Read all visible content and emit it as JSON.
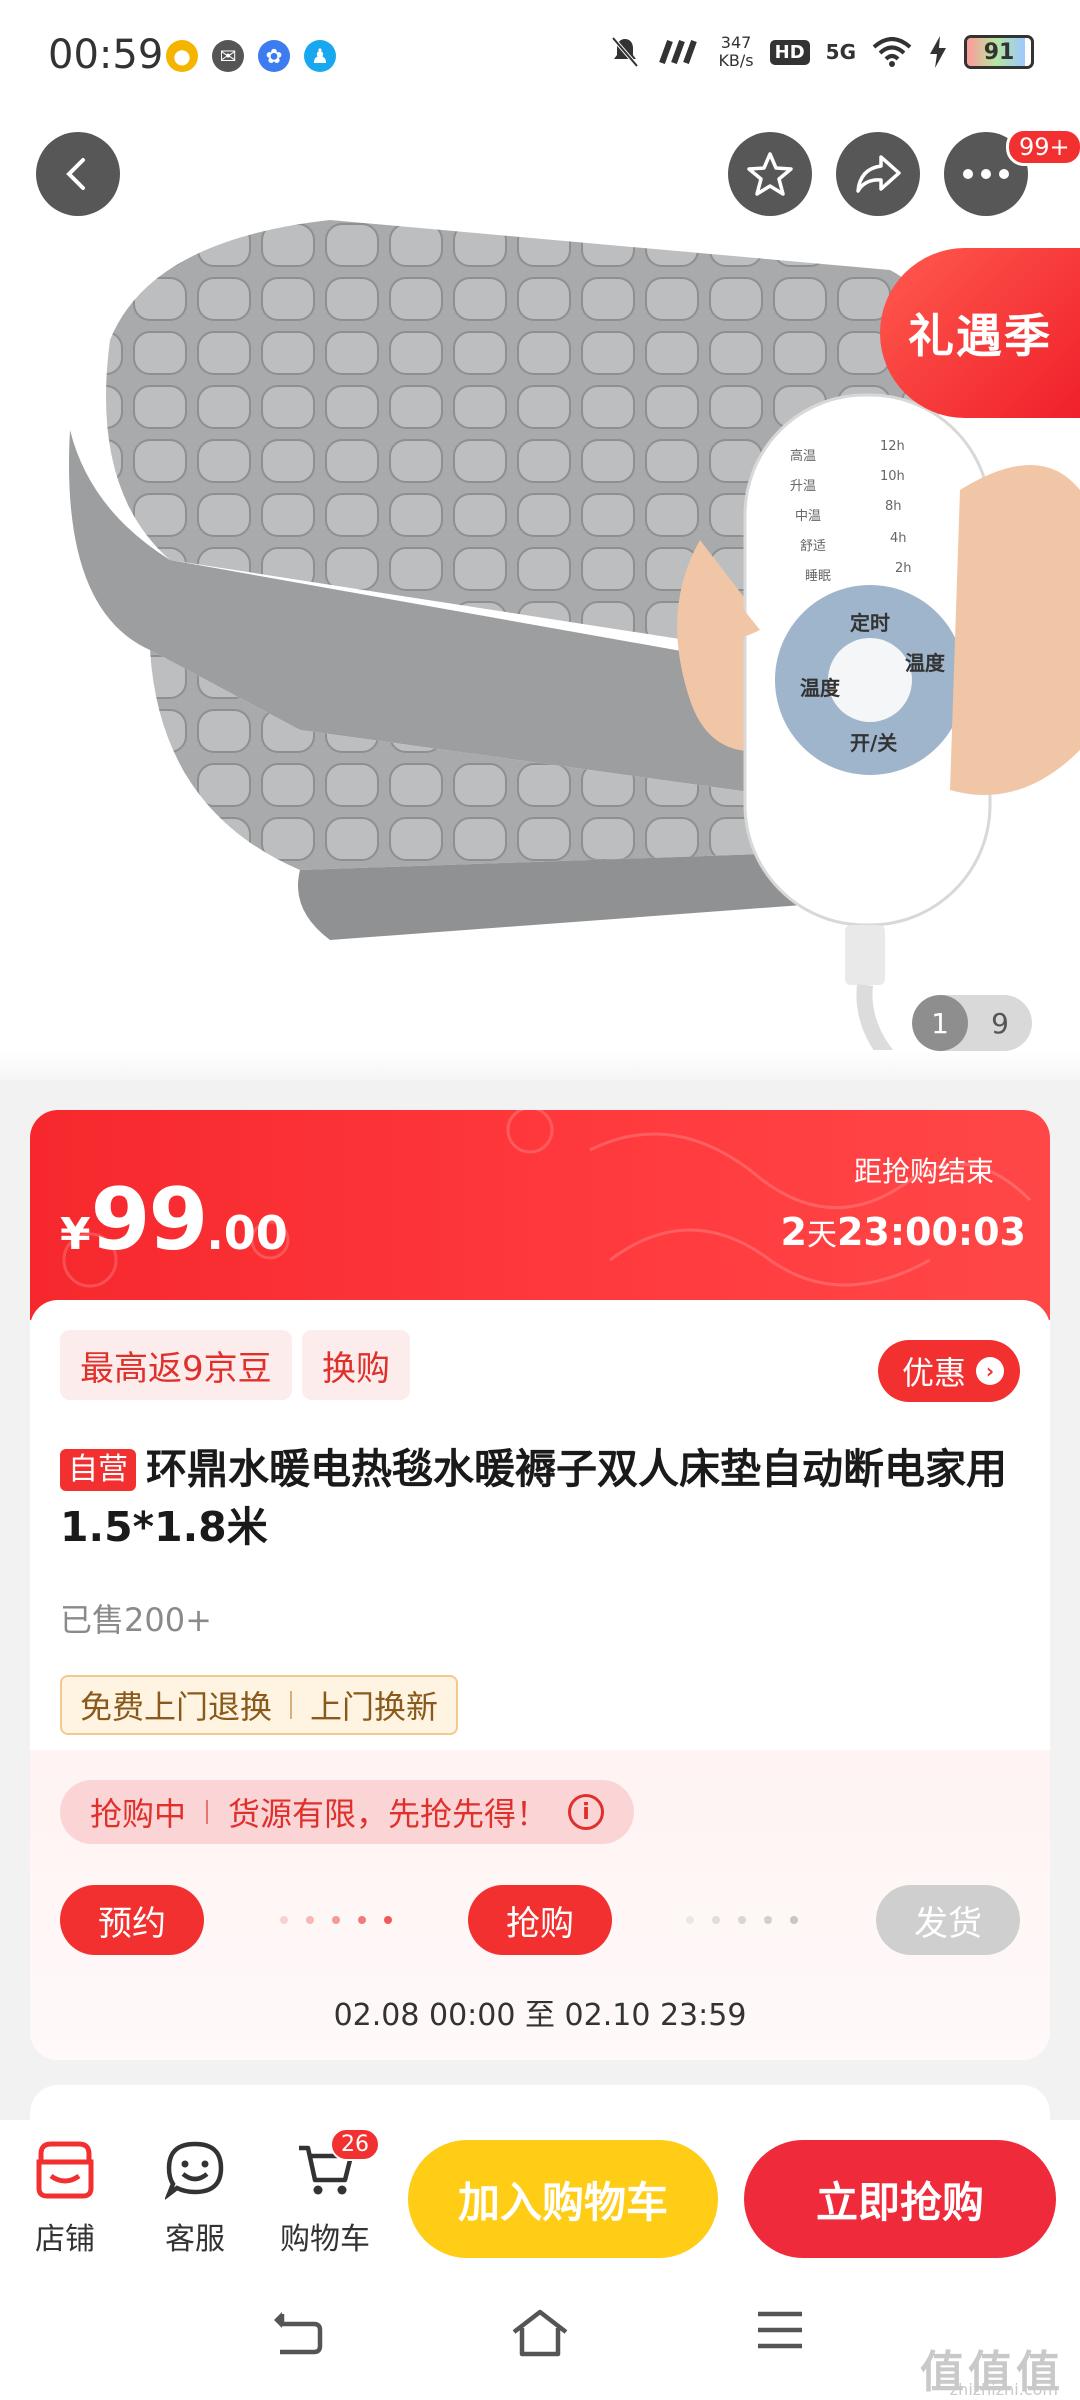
{
  "status_bar": {
    "time": "00:59",
    "net_speed_value": "347",
    "net_speed_unit": "KB/s",
    "hd": "HD",
    "network": "5G",
    "battery": "91",
    "battery_level": 0.91
  },
  "hero": {
    "gift_tag": "礼遇季",
    "more_badge": "99+",
    "image_current": "1",
    "image_total": "9"
  },
  "price_card": {
    "currency": "¥",
    "price_int": "99",
    "price_dec": ".00",
    "countdown_label": "距抢购结束",
    "countdown_days": "2",
    "countdown_day_unit": "天",
    "countdown_time": "23:00:03",
    "tags": [
      "最高返9京豆",
      "换购"
    ],
    "discount_label": "优惠",
    "self_tag": "自营",
    "title": "环鼎水暖电热毯水暖褥子双人床垫自动断电家用1.5*1.8米",
    "sold": "已售200+",
    "services": [
      "免费上门退换",
      "上门换新"
    ],
    "flash_status": "抢购中",
    "flash_note": "货源有限，先抢先得！",
    "steps": [
      "预约",
      "抢购",
      "发货"
    ],
    "period": "02.08 00:00 至 02.10 23:59"
  },
  "action_bar": {
    "store_label": "店铺",
    "service_label": "客服",
    "cart_label": "购物车",
    "cart_count": "26",
    "add_to_cart": "加入购物车",
    "buy_now": "立即抢购"
  },
  "watermark": {
    "main": "值值值",
    "sub": "zhizhizhi.com"
  },
  "colors": {
    "accent": "#f23030",
    "cart_button": "#ffcc16",
    "buy_button": "#ef2a3a"
  }
}
